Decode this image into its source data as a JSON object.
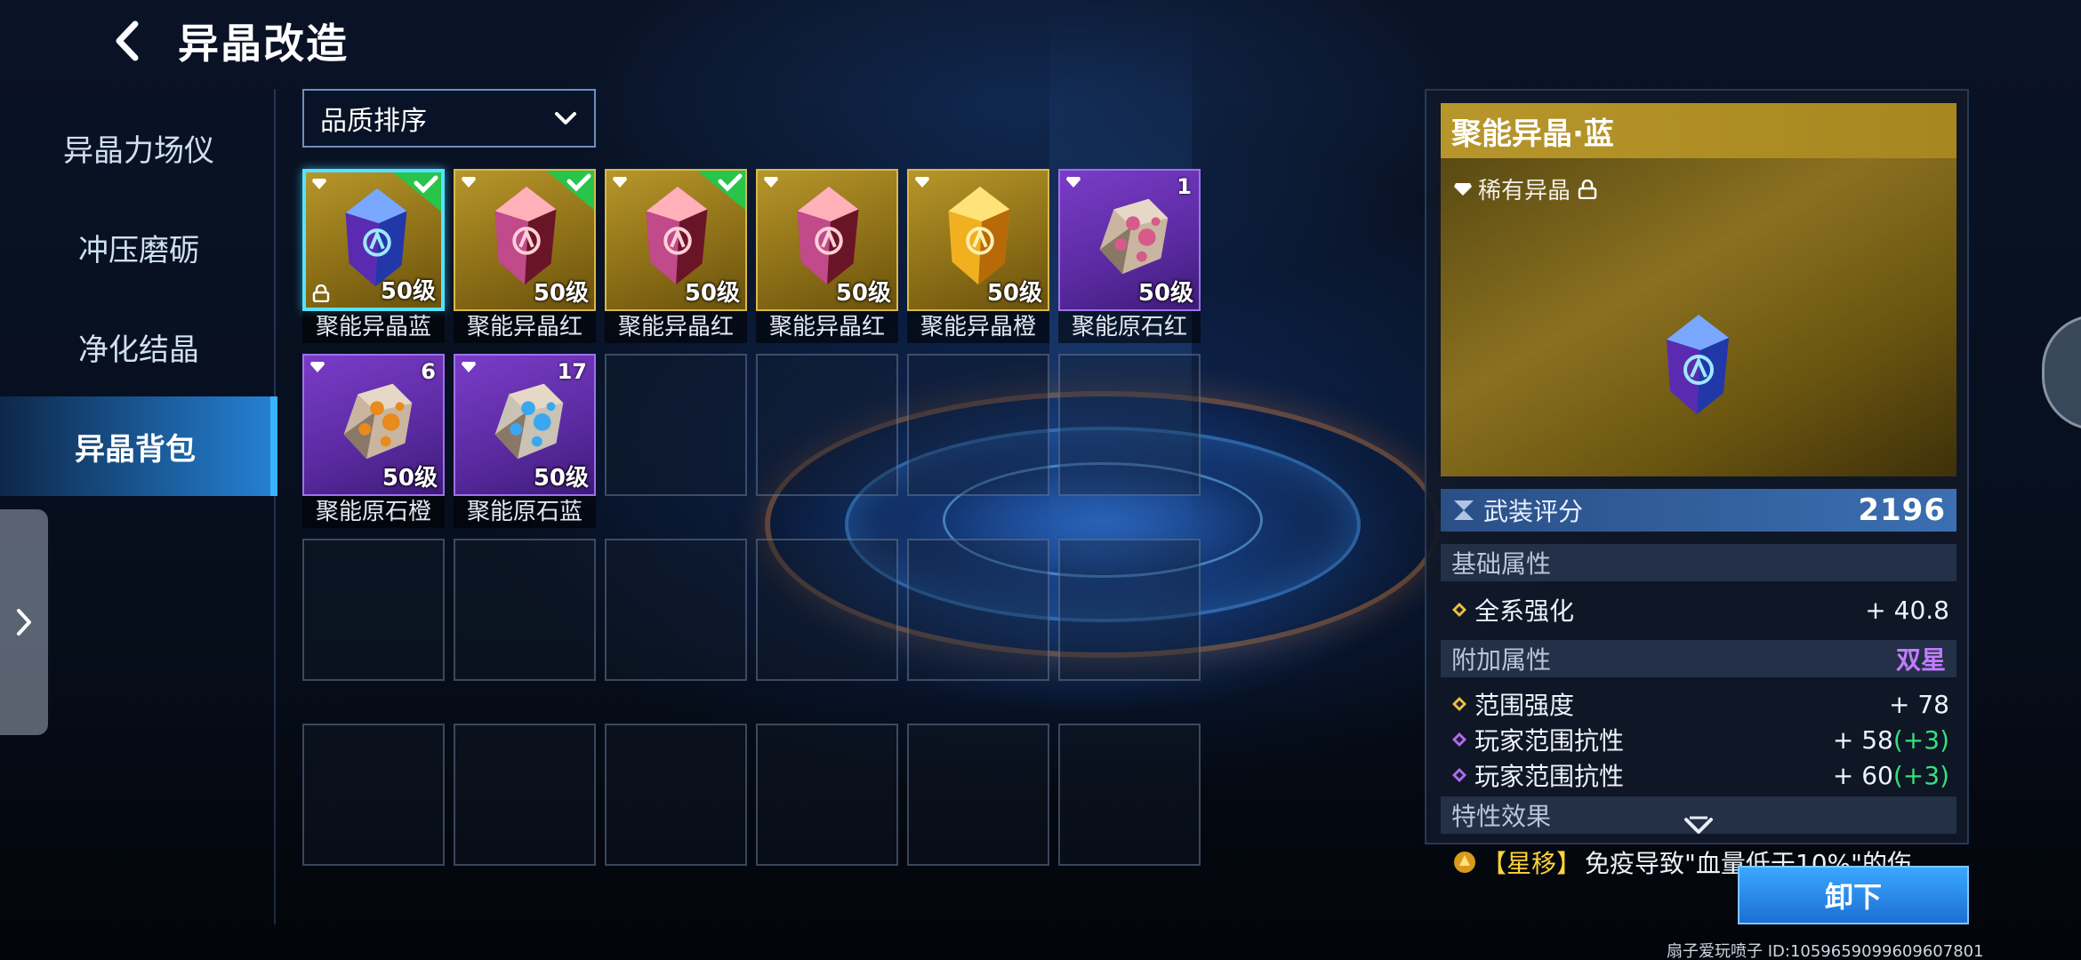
{
  "header": {
    "title": "异晶改造",
    "back_icon": "back-arrow-icon"
  },
  "nav": {
    "items": [
      {
        "label": "异晶力场仪",
        "active": false
      },
      {
        "label": "冲压磨砺",
        "active": false
      },
      {
        "label": "净化结晶",
        "active": false
      },
      {
        "label": "异晶背包",
        "active": true
      }
    ]
  },
  "sort": {
    "label": "品质排序"
  },
  "inventory": {
    "items": [
      {
        "name": "聚能异晶蓝",
        "level": "50级",
        "rarity": "gold",
        "gem": "blue-crystal",
        "equipped": true,
        "locked": true,
        "selected": true,
        "count": ""
      },
      {
        "name": "聚能异晶红",
        "level": "50级",
        "rarity": "gold",
        "gem": "red-crystal",
        "equipped": true,
        "locked": false,
        "selected": false,
        "count": ""
      },
      {
        "name": "聚能异晶红",
        "level": "50级",
        "rarity": "gold",
        "gem": "red-crystal",
        "equipped": true,
        "locked": false,
        "selected": false,
        "count": ""
      },
      {
        "name": "聚能异晶红",
        "level": "50级",
        "rarity": "gold",
        "gem": "red-crystal",
        "equipped": false,
        "locked": false,
        "selected": false,
        "count": ""
      },
      {
        "name": "聚能异晶橙",
        "level": "50级",
        "rarity": "gold",
        "gem": "orange-crystal",
        "equipped": false,
        "locked": false,
        "selected": false,
        "count": ""
      },
      {
        "name": "聚能原石红",
        "level": "50级",
        "rarity": "purple",
        "gem": "red-ore",
        "equipped": false,
        "locked": false,
        "selected": false,
        "count": "1"
      },
      {
        "name": "聚能原石橙",
        "level": "50级",
        "rarity": "purple",
        "gem": "orange-ore",
        "equipped": false,
        "locked": false,
        "selected": false,
        "count": "6"
      },
      {
        "name": "聚能原石蓝",
        "level": "50级",
        "rarity": "purple",
        "gem": "blue-ore",
        "equipped": false,
        "locked": false,
        "selected": false,
        "count": "17"
      }
    ],
    "empty_slots": 16
  },
  "detail": {
    "name": "聚能异晶·蓝",
    "rarity_label": "稀有异晶",
    "score_label": "武装评分",
    "score_value": "2196",
    "base_title": "基础属性",
    "base_attrs": [
      {
        "name": "全系强化",
        "value": "+ 40.8",
        "bonus": ""
      }
    ],
    "extra_title": "附加属性",
    "extra_tag": "双星",
    "extra_attrs": [
      {
        "name": "范围强度",
        "value": "+ 78",
        "bonus": "",
        "color": "#f0c040"
      },
      {
        "name": "玩家范围抗性",
        "value": "+ 58",
        "bonus": "(+3)",
        "color": "#b06cf0"
      },
      {
        "name": "玩家范围抗性",
        "value": "+ 60",
        "bonus": "(+3)",
        "color": "#b06cf0"
      }
    ],
    "trait_title": "特性效果",
    "trait_name": "星移",
    "trait_text": "免疫导致\"血量低于10%\"的伤"
  },
  "actions": {
    "unload_label": "卸下"
  },
  "watermark": "扇子爱玩喷子 ID:1059659099609607801",
  "colors": {
    "gold": "#b7962a",
    "purple": "#7a3cc8",
    "accent": "#39b2ff",
    "bonus": "#37e07a",
    "double_star": "#c27cff"
  }
}
